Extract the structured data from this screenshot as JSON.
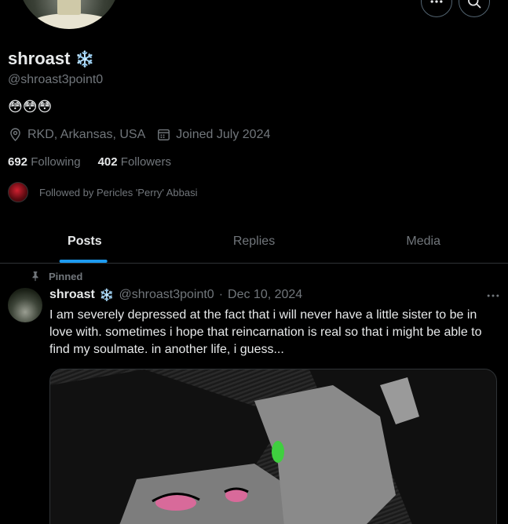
{
  "profile": {
    "display_name": "shroast",
    "name_emoji": "❄️",
    "handle": "@shroast3point0",
    "bio": "😳😳😳",
    "location": "RKD, Arkansas, USA",
    "joined": "Joined July 2024",
    "following_count": "692",
    "following_label": "Following",
    "followers_count": "402",
    "followers_label": "Followers",
    "followed_by": "Followed by Pericles 'Perry' Abbasi"
  },
  "tabs": [
    {
      "label": "Posts",
      "active": true
    },
    {
      "label": "Replies",
      "active": false
    },
    {
      "label": "Media",
      "active": false
    }
  ],
  "post": {
    "pinned_label": "Pinned",
    "author_name": "shroast",
    "author_emoji": "❄️",
    "handle": "@shroast3point0",
    "separator": "·",
    "date": "Dec 10, 2024",
    "text": "I am severely depressed at the fact that i will never have a little sister to be in love with. sometimes i hope that reincarnation is real so that i might be able to find my soulmate. in another life, i guess..."
  },
  "icons": {
    "more": "more-horizontal-icon",
    "search": "search-icon",
    "location": "location-pin-icon",
    "calendar": "calendar-icon",
    "pin": "pin-icon"
  },
  "colors": {
    "accent": "#1d9bf0",
    "background": "#000000",
    "text_primary": "#e7e9ea",
    "text_secondary": "#71767b"
  }
}
